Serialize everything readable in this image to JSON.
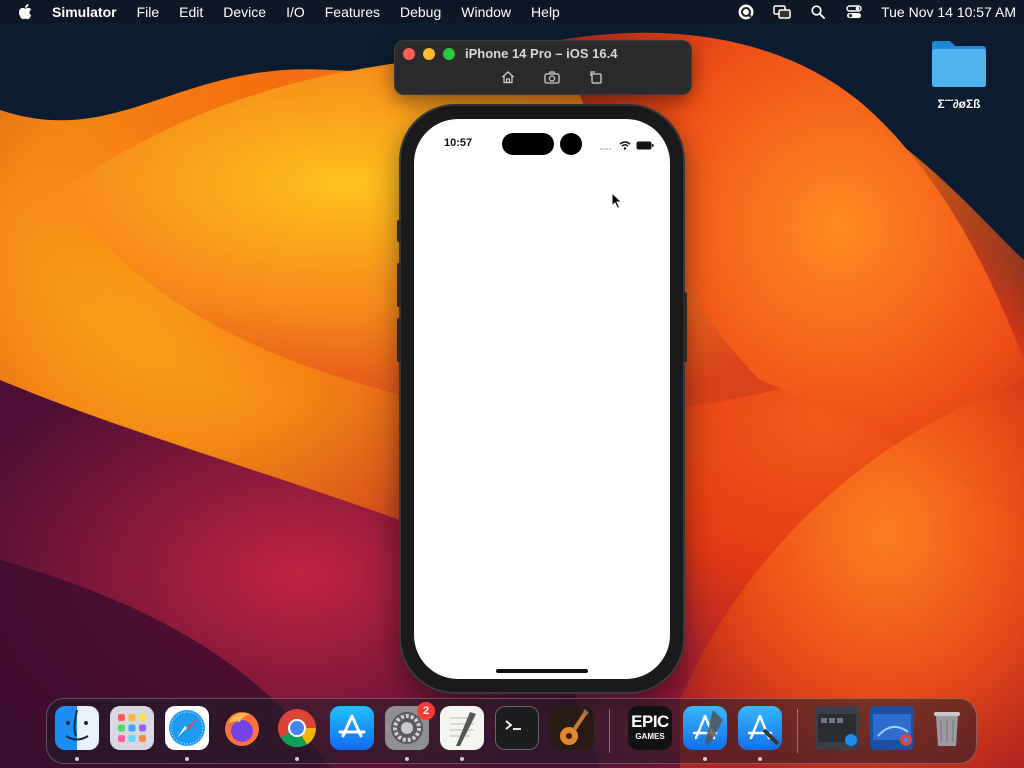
{
  "menubar": {
    "app_name": "Simulator",
    "menus": [
      "File",
      "Edit",
      "Device",
      "I/O",
      "Features",
      "Debug",
      "Window",
      "Help"
    ],
    "clock": "Tue Nov 14  10:57 AM",
    "status_icons": [
      "screen-record-icon",
      "screen-mirroring-icon",
      "spotlight-search-icon",
      "control-center-icon"
    ]
  },
  "simulator_window": {
    "title": "iPhone 14 Pro – iOS 16.4",
    "toolbar": [
      "home-icon",
      "screenshot-icon",
      "rotate-icon"
    ]
  },
  "phone": {
    "status_time": "10:57",
    "status_icons": [
      "signal-icon",
      "wifi-icon",
      "battery-icon"
    ]
  },
  "desktop": {
    "folder_label": "Σ˜˜∂øΣß"
  },
  "dock": {
    "apps": [
      {
        "name": "Finder",
        "icon": "finder-icon",
        "running": true
      },
      {
        "name": "Launchpad",
        "icon": "launchpad-icon",
        "running": false
      },
      {
        "name": "Safari",
        "icon": "safari-icon",
        "running": true
      },
      {
        "name": "Firefox",
        "icon": "firefox-icon",
        "running": false
      },
      {
        "name": "Google Chrome",
        "icon": "chrome-icon",
        "running": true
      },
      {
        "name": "App Store",
        "icon": "app-store-icon",
        "running": false
      },
      {
        "name": "System Settings",
        "icon": "system-settings-icon",
        "running": true,
        "badge": "2"
      },
      {
        "name": "TextEdit",
        "icon": "textedit-icon",
        "running": true
      },
      {
        "name": "Terminal",
        "icon": "terminal-icon",
        "running": false
      },
      {
        "name": "GarageBand",
        "icon": "garageband-icon",
        "running": false
      },
      {
        "name": "Epic Games Launcher",
        "icon": "epic-games-icon",
        "running": false,
        "text": [
          "EPIC",
          "GAMES"
        ]
      },
      {
        "name": "Xcode",
        "icon": "xcode-icon",
        "running": true
      },
      {
        "name": "Instruments",
        "icon": "xcode-tools-icon",
        "running": true
      },
      {
        "name": "Recent Window 1",
        "icon": "recent-window-icon",
        "running": false
      },
      {
        "name": "Recent Window 2",
        "icon": "recent-window-chrome-icon",
        "running": false
      },
      {
        "name": "Trash",
        "icon": "trash-icon",
        "running": false
      }
    ]
  }
}
